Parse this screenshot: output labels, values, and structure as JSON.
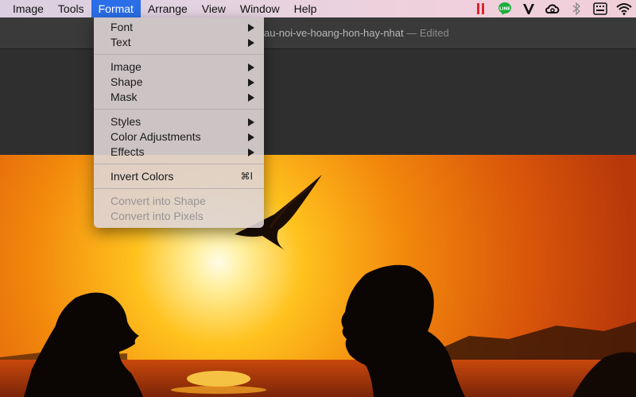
{
  "menubar": {
    "items": [
      "Image",
      "Tools",
      "Format",
      "Arrange",
      "View",
      "Window",
      "Help"
    ],
    "active_index": 2,
    "status_icons": [
      "parallels-pause-icon",
      "line-app-icon",
      "vectorize-v-icon",
      "creative-cloud-icon",
      "bluetooth-icon",
      "keyboard-input-icon",
      "wifi-icon"
    ],
    "status_badges": {
      "line": "LINE"
    }
  },
  "window": {
    "doc_title": "au-noi-ve-hoang-hon-hay-nhat",
    "edited_label": "— Edited"
  },
  "format_menu": {
    "group1": [
      {
        "label": "Font"
      },
      {
        "label": "Text"
      }
    ],
    "group2": [
      {
        "label": "Image"
      },
      {
        "label": "Shape"
      },
      {
        "label": "Mask"
      }
    ],
    "group3": [
      {
        "label": "Styles"
      },
      {
        "label": "Color Adjustments"
      },
      {
        "label": "Effects"
      }
    ],
    "group4": [
      {
        "label": "Invert Colors",
        "shortcut": "⌘I"
      }
    ],
    "group5": [
      {
        "label": "Convert into Shape"
      },
      {
        "label": "Convert into Pixels"
      }
    ]
  },
  "colors": {
    "menu_highlight": "#2a6ee8",
    "sunset_orange": "#f28a10",
    "sky_yellow": "#f4b81a"
  }
}
